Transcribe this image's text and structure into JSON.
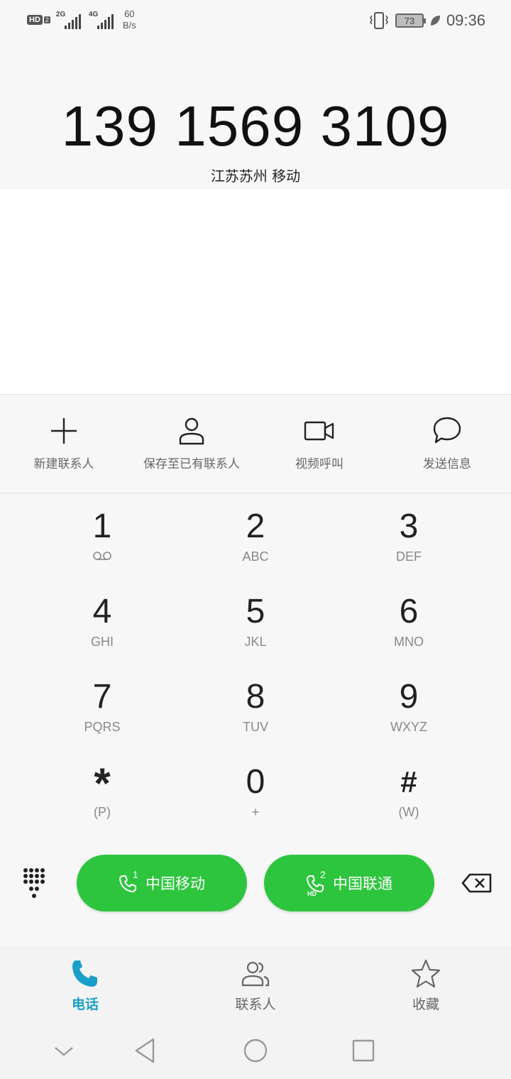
{
  "status_bar": {
    "hd_label": "HD",
    "hd_sim": "2",
    "sim1_network": "2G",
    "sim2_network": "4G",
    "speed_value": "60",
    "speed_unit": "B/s",
    "battery_level": "73",
    "time": "09:36"
  },
  "dialer": {
    "number": "139 1569 3109",
    "location": "江苏苏州 移动"
  },
  "actions": [
    {
      "label": "新建联系人",
      "icon": "add-icon"
    },
    {
      "label": "保存至已有联系人",
      "icon": "person-icon"
    },
    {
      "label": "视频呼叫",
      "icon": "video-icon"
    },
    {
      "label": "发送信息",
      "icon": "message-icon"
    }
  ],
  "keypad": {
    "k1": {
      "digit": "1",
      "letters": ""
    },
    "k2": {
      "digit": "2",
      "letters": "ABC"
    },
    "k3": {
      "digit": "3",
      "letters": "DEF"
    },
    "k4": {
      "digit": "4",
      "letters": "GHI"
    },
    "k5": {
      "digit": "5",
      "letters": "JKL"
    },
    "k6": {
      "digit": "6",
      "letters": "MNO"
    },
    "k7": {
      "digit": "7",
      "letters": "PQRS"
    },
    "k8": {
      "digit": "8",
      "letters": "TUV"
    },
    "k9": {
      "digit": "9",
      "letters": "WXYZ"
    },
    "kstar": {
      "digit": "*",
      "letters": "(P)"
    },
    "k0": {
      "digit": "0",
      "letters": "+"
    },
    "khash": {
      "digit": "#",
      "letters": "(W)"
    }
  },
  "call": {
    "sim1_index": "1",
    "sim1_label": "中国移动",
    "sim2_index": "2",
    "sim2_hd": "HD",
    "sim2_label": "中国联通",
    "button_color": "#2ec53e"
  },
  "tabs": [
    {
      "label": "电话",
      "icon": "phone-icon",
      "active": true
    },
    {
      "label": "联系人",
      "icon": "contacts-icon",
      "active": false
    },
    {
      "label": "收藏",
      "icon": "star-icon",
      "active": false
    }
  ],
  "colors": {
    "accent": "#1aa0c8",
    "call_green": "#2ec53e"
  }
}
